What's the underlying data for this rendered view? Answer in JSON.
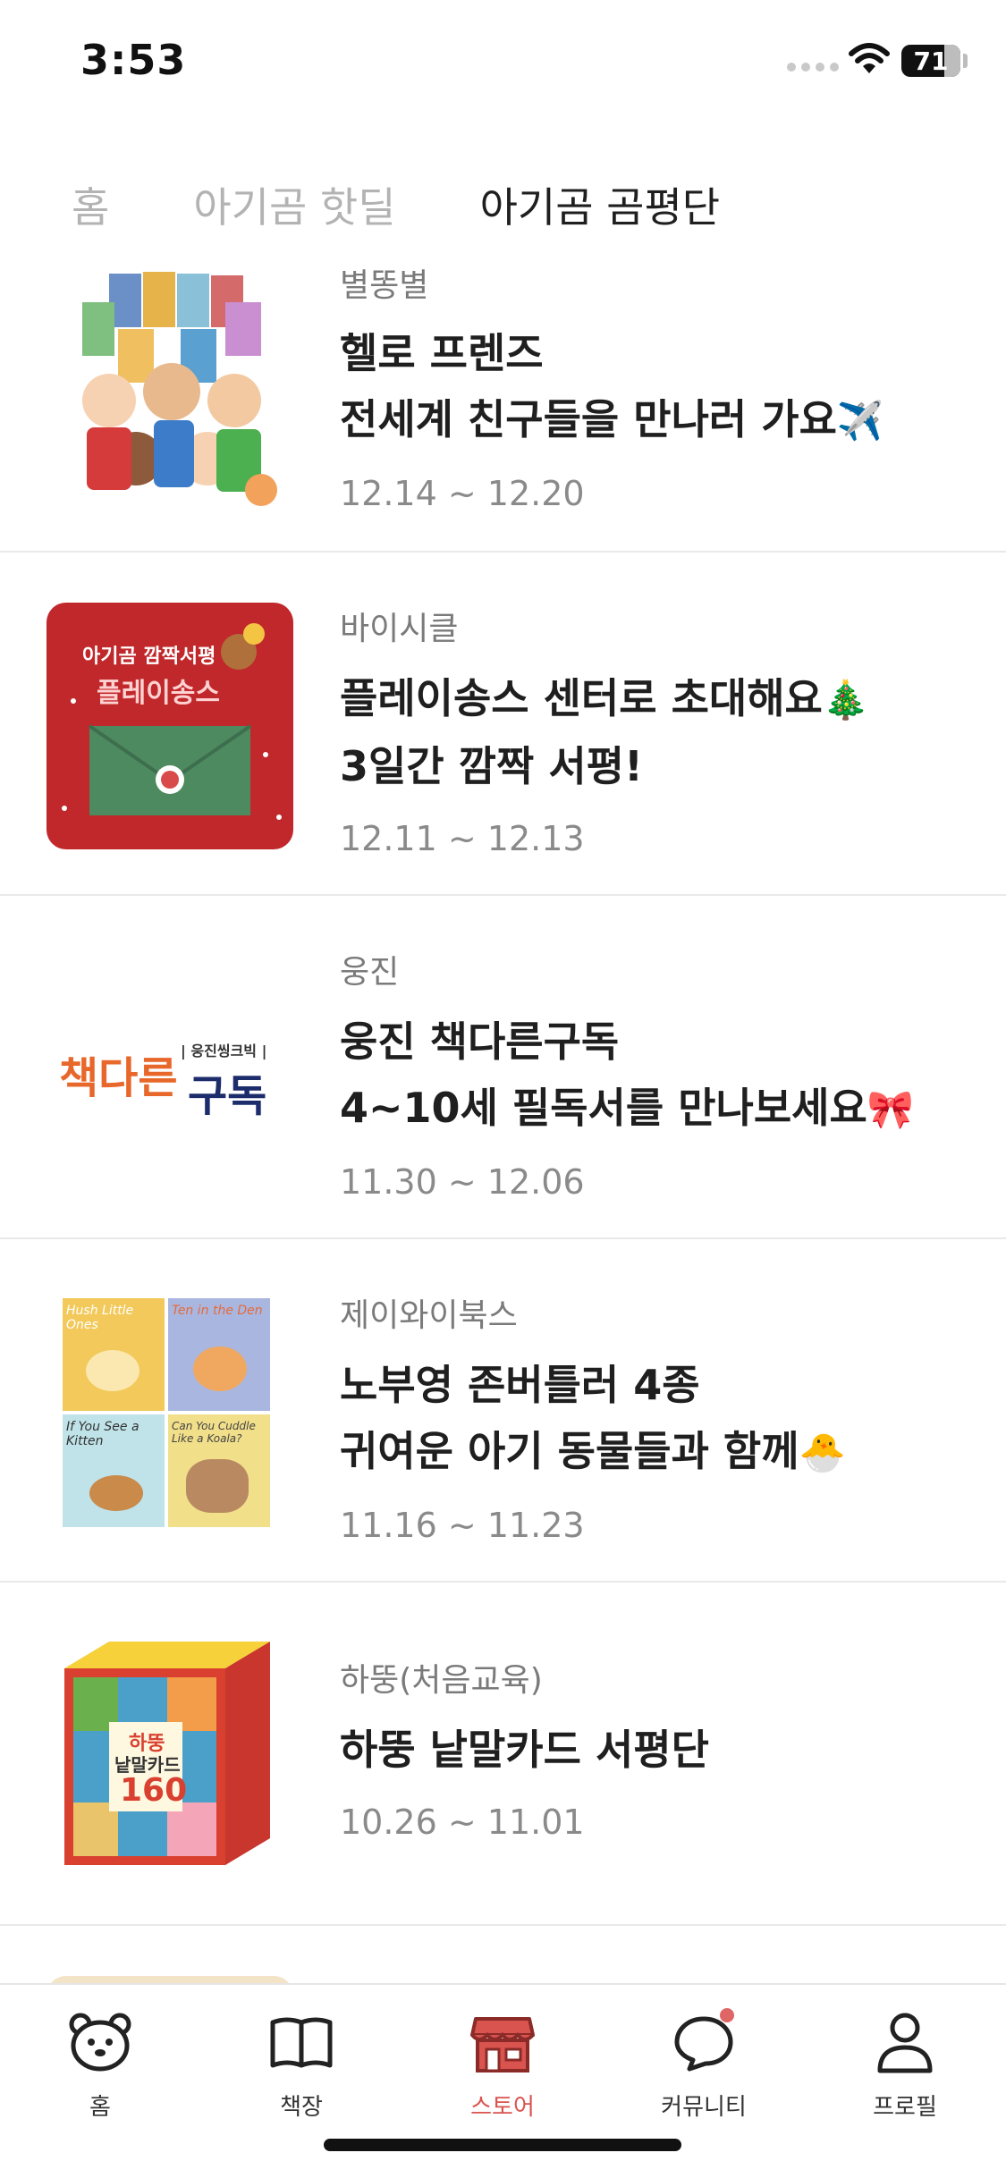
{
  "status": {
    "time": "3:53",
    "battery": "71"
  },
  "tabs": [
    {
      "label": "홈"
    },
    {
      "label": "아기곰 핫딜"
    },
    {
      "label": "아기곰 곰평단"
    }
  ],
  "items": [
    {
      "publisher": "별똥별",
      "title1": "헬로 프렌즈",
      "title2": "전세계 친구들을 만나러 가요",
      "title2_emoji": "✈️",
      "date": "12.14 ~ 12.20"
    },
    {
      "publisher": "바이시클",
      "title1": "플레이송스 센터로 초대해요",
      "title1_emoji": "🎄",
      "title2": "3일간 깜짝 서평!",
      "date": "12.11 ~ 12.13",
      "thumb_text1": "아기곰 깜짝서평",
      "thumb_text2": "플레이송스"
    },
    {
      "publisher": "웅진",
      "title1": "웅진 책다른구독",
      "title2": "4~10세 필독서를 만나보세요",
      "title2_emoji": "🎀",
      "date": "11.30 ~ 12.06",
      "thumb_logo_a": "책다른",
      "thumb_logo_b": "구독",
      "thumb_logo_c": "| 웅진씽크빅 |"
    },
    {
      "publisher": "제이와이북스",
      "title1": "노부영 존버틀러 4종",
      "title2": "귀여운 아기 동물들과 함께",
      "title2_emoji": "🐣",
      "date": "11.16 ~ 11.23",
      "covers": [
        "Hush Little Ones",
        "Ten in the Den",
        "If You See a Kitten",
        "Can You Cuddle Like a Koala?"
      ]
    },
    {
      "publisher": "하뚱(처음교육)",
      "title1": "하뚱 낱말카드 서평단",
      "date": "10.26 ~ 11.01",
      "thumb_text1": "하뚱",
      "thumb_text2": "낱말카드",
      "thumb_num": "160"
    }
  ],
  "nav": [
    {
      "label": "홈",
      "icon": "bear-icon"
    },
    {
      "label": "책장",
      "icon": "book-icon"
    },
    {
      "label": "스토어",
      "icon": "store-icon"
    },
    {
      "label": "커뮤니티",
      "icon": "chat-icon"
    },
    {
      "label": "프로필",
      "icon": "person-icon"
    }
  ],
  "colors": {
    "accent": "#d9534f",
    "inactive_tab": "#b3b3b3"
  }
}
